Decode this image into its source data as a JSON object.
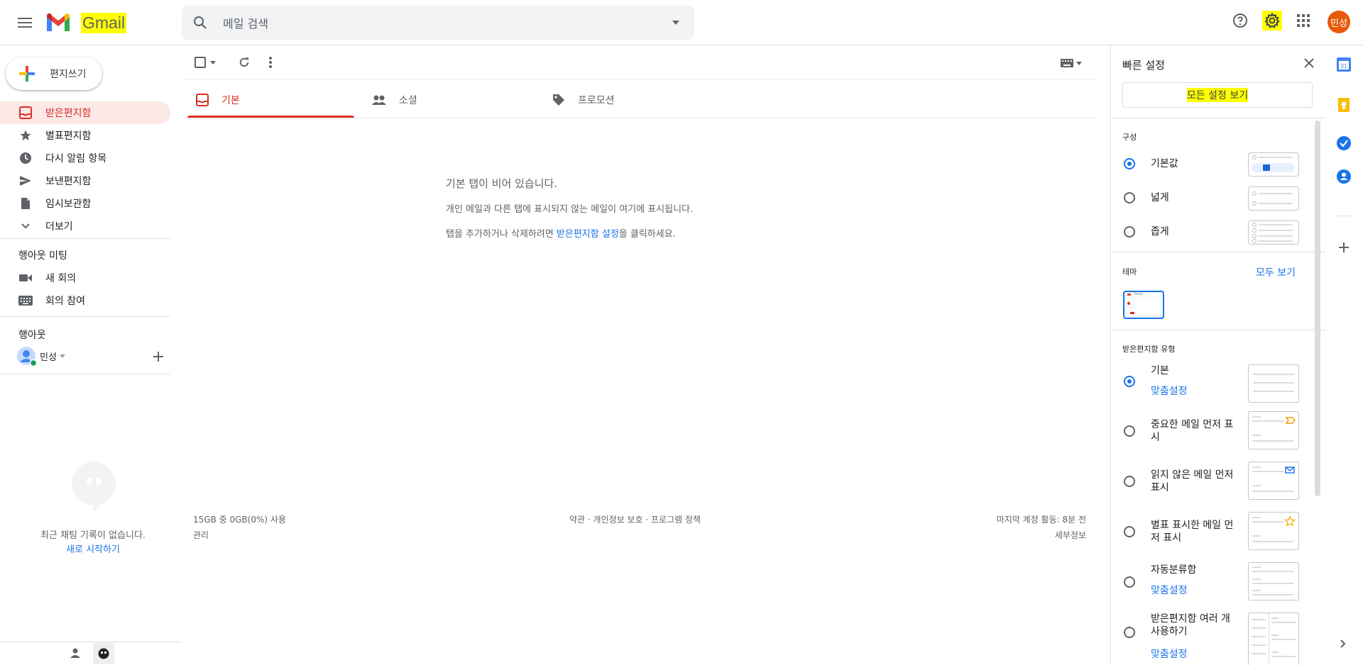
{
  "header": {
    "app_name": "Gmail",
    "search_placeholder": "메일 검색",
    "avatar_initials": "민성"
  },
  "nav": {
    "compose_label": "편지쓰기",
    "items": [
      {
        "label": "받은편지함",
        "icon": "inbox-icon",
        "active": true
      },
      {
        "label": "별표편지함",
        "icon": "star-icon"
      },
      {
        "label": "다시 알림 항목",
        "icon": "clock-icon"
      },
      {
        "label": "보낸편지함",
        "icon": "send-icon"
      },
      {
        "label": "임시보관함",
        "icon": "draft-icon"
      },
      {
        "label": "더보기",
        "icon": "chevron-down-icon"
      }
    ],
    "meet_title": "행아웃 미팅",
    "meet_items": [
      {
        "label": "새 회의",
        "icon": "video-icon"
      },
      {
        "label": "회의 참여",
        "icon": "keyboard-icon"
      }
    ],
    "hangouts_title": "행아웃",
    "hangouts_user": "민성",
    "chat_empty": "최근 채팅 기록이 없습니다.",
    "chat_start": "새로 시작하기"
  },
  "tabs": [
    {
      "label": "기본",
      "icon": "inbox-icon",
      "active": true
    },
    {
      "label": "소셜",
      "icon": "people-icon"
    },
    {
      "label": "프로모션",
      "icon": "tag-icon"
    }
  ],
  "empty_state": {
    "title": "기본 탭이 비어 있습니다.",
    "line1": "개인 메일과 다른 탭에 표시되지 않는 메일이 여기에 표시됩니다.",
    "line2_prefix": "탭을 추가하거나 삭제하려면 ",
    "line2_link": "받은편지함 설정",
    "line2_suffix": "을 클릭하세요."
  },
  "footer": {
    "storage": "15GB 중 0GB(0%) 사용",
    "manage": "관리",
    "policy": "약관 · 개인정보 보호 · 프로그램 정책",
    "last_activity": "마지막 계정 활동: 8분 전",
    "details": "세부정보"
  },
  "quick_settings": {
    "title": "빠른 설정",
    "all_settings": "모든 설정 보기",
    "density_label": "구성",
    "density_options": [
      {
        "label": "기본값",
        "selected": true
      },
      {
        "label": "넓게",
        "selected": false
      },
      {
        "label": "좁게",
        "selected": false
      }
    ],
    "theme_label": "테마",
    "theme_view_all": "모두 보기",
    "theme_thumb_text": "Gmail",
    "inbox_type_label": "받은편지함 유형",
    "inbox_types": [
      {
        "label": "기본",
        "link": "맞춤설정",
        "selected": true
      },
      {
        "label": "중요한 메일 먼저 표시",
        "selected": false
      },
      {
        "label": "읽지 않은 메일 먼저 표시",
        "selected": false
      },
      {
        "label": "별표 표시한 메일 먼저 표시",
        "selected": false
      },
      {
        "label": "자동분류함",
        "link": "맞춤설정",
        "selected": false
      },
      {
        "label": "받은편지함 여러 개 사용하기",
        "link": "맞춤설정",
        "selected": false
      }
    ]
  },
  "side_rail": {
    "calendar_day": "31"
  },
  "colors": {
    "accent_red": "#d93025",
    "link_blue": "#1a73e8",
    "highlight": "#ffff00"
  }
}
